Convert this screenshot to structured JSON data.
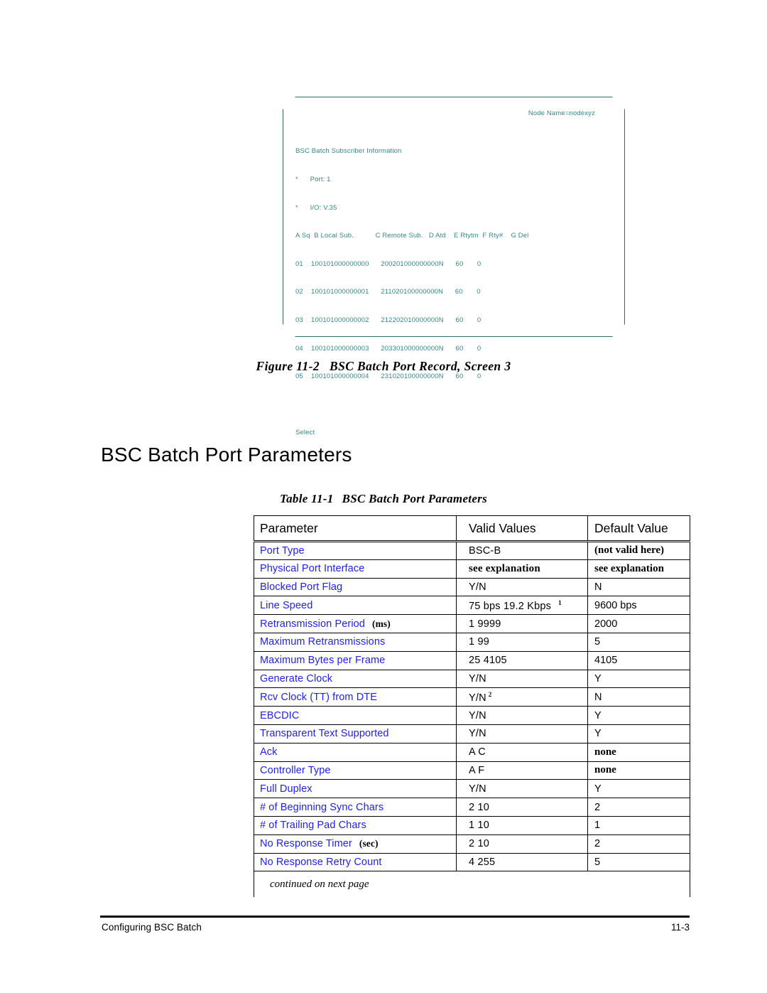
{
  "figure": {
    "caption_number": "Figure 11-2",
    "caption_title": "BSC Batch Port Record, Screen 3",
    "terminal": {
      "node_name": "Node Name=nodexyz",
      "title": "BSC Batch Subscriber Information",
      "field_port": "*      Port: 1",
      "field_io": "*      I/O: V.35",
      "column_header": "A Sq  B Local Sub.           C Remote Sub.   D Atd    E Rtytm  F Rty#    G Del",
      "rows": [
        "01    100101000000000      200201000000000N      60       0",
        "02    100101000000001      211020100000000N      60       0",
        "03    100101000000002      212202010000000N      60       0",
        "04    100101000000003      203301000000000N      60       0",
        "05    100101000000004      231020100000000N      60       0"
      ],
      "prompt": "Select",
      "text_color": "#34888a",
      "frame_color": "#2f6b6b"
    }
  },
  "section_heading": "BSC Batch Port Parameters",
  "table": {
    "caption_number": "Table 11-1",
    "caption_title": "BSC Batch Port Parameters",
    "headers": {
      "parameter": "Parameter",
      "valid_values": "Valid Values",
      "default_value": "Default Value"
    },
    "param_color": "#2020f0",
    "rows": [
      {
        "parameter": "Port Type",
        "unit": "",
        "valid": "BSC-B",
        "valid_sup": "",
        "default": "(not valid here)",
        "valid_style": "sans",
        "default_style": "serif-bold"
      },
      {
        "parameter": "Physical Port Interface",
        "unit": "",
        "valid": "see explanation",
        "valid_sup": "",
        "default": "see explanation",
        "valid_style": "serif-bold",
        "default_style": "serif-bold"
      },
      {
        "parameter": "Blocked Port Flag",
        "unit": "",
        "valid": "Y/N",
        "valid_sup": "",
        "default": "N",
        "valid_style": "sans",
        "default_style": "sans"
      },
      {
        "parameter": "Line Speed",
        "unit": "",
        "valid": "75 bps   19.2 Kbps",
        "valid_sup": "1",
        "default": "9600 bps",
        "valid_style": "sans",
        "default_style": "sans"
      },
      {
        "parameter": "Retransmission Period",
        "unit": "(ms)",
        "valid": "1  9999",
        "valid_sup": "",
        "default": "2000",
        "valid_style": "sans",
        "default_style": "sans"
      },
      {
        "parameter": "Maximum Retransmissions",
        "unit": "",
        "valid": "1  99",
        "valid_sup": "",
        "default": "5",
        "valid_style": "sans",
        "default_style": "sans"
      },
      {
        "parameter": "Maximum Bytes per Frame",
        "unit": "",
        "valid": "25  4105",
        "valid_sup": "",
        "default": "4105",
        "valid_style": "sans",
        "default_style": "sans"
      },
      {
        "parameter": "Generate Clock",
        "unit": "",
        "valid": "Y/N",
        "valid_sup": "",
        "default": "Y",
        "valid_style": "sans",
        "default_style": "sans"
      },
      {
        "parameter": "Rcv Clock (TT) from DTE",
        "unit": "",
        "valid": "Y/N",
        "valid_sup": "2",
        "default": "N",
        "valid_style": "sans",
        "default_style": "sans"
      },
      {
        "parameter": "EBCDIC",
        "unit": "",
        "valid": "Y/N",
        "valid_sup": "",
        "default": "Y",
        "valid_style": "sans",
        "default_style": "sans"
      },
      {
        "parameter": "Transparent Text Supported",
        "unit": "",
        "valid": "Y/N",
        "valid_sup": "",
        "default": "Y",
        "valid_style": "sans",
        "default_style": "sans"
      },
      {
        "parameter": "Ack",
        "unit": "",
        "valid": "A  C",
        "valid_sup": "",
        "default": "none",
        "valid_style": "sans",
        "default_style": "serif-bold"
      },
      {
        "parameter": "Controller Type",
        "unit": "",
        "valid": "A  F",
        "valid_sup": "",
        "default": "none",
        "valid_style": "sans",
        "default_style": "serif-bold"
      },
      {
        "parameter": "Full Duplex",
        "unit": "",
        "valid": "Y/N",
        "valid_sup": "",
        "default": "Y",
        "valid_style": "sans",
        "default_style": "sans"
      },
      {
        "parameter": "# of Beginning Sync Chars",
        "unit": "",
        "valid": "2  10",
        "valid_sup": "",
        "default": "2",
        "valid_style": "sans",
        "default_style": "sans"
      },
      {
        "parameter": "# of Trailing Pad Chars",
        "unit": "",
        "valid": "1  10",
        "valid_sup": "",
        "default": "1",
        "valid_style": "sans",
        "default_style": "sans"
      },
      {
        "parameter": "No Response Timer",
        "unit": "(sec)",
        "valid": "2  10",
        "valid_sup": "",
        "default": "2",
        "valid_style": "sans",
        "default_style": "sans"
      },
      {
        "parameter": "No Response Retry Count",
        "unit": "",
        "valid": "4  255",
        "valid_sup": "",
        "default": "5",
        "valid_style": "sans",
        "default_style": "sans"
      }
    ],
    "continued_note": "continued on next page"
  },
  "footer": {
    "left": "Configuring BSC Batch",
    "right": "11-3"
  }
}
